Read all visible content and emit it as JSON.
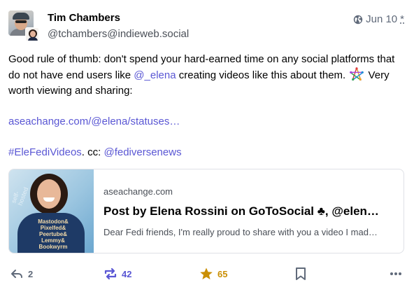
{
  "post": {
    "author": {
      "display_name": "Tim Chambers",
      "handle": "@tchambers@indieweb.social"
    },
    "timestamp": {
      "date": "Jun 10",
      "edited_marker": "*",
      "visibility_icon": "globe-icon"
    },
    "content": {
      "p1_before_mention": "Good rule of thumb: don't spend your hard-earned time on any social platforms that do not have end users like ",
      "p1_mention": "@_elena",
      "p1_after_mention": " creating videos like this about them.",
      "p1_emoji": "fediverse-star-emoji",
      "p1_end": " Very worth viewing and sharing:",
      "link_text": "aseachange.com/@elena/statuses…",
      "hashtag": "#EleFediVideos",
      "cc_text": ". cc: ",
      "cc_mention": "@fediversenews"
    },
    "card": {
      "site": "aseachange.com",
      "title": "Post by Elena Rossini on GoToSocial ♣, @elen…",
      "description": "Dear Fedi friends, I'm really proud to share with you a video I mad…",
      "thumbnail_text": "Mastodon& Pixelfed& Peertube& Lemmy& Bookwyrm",
      "thumbnail_script": "self-hosted"
    },
    "actions": {
      "reply_count": "2",
      "boost_count": "42",
      "favourite_count": "65",
      "colors": {
        "muted": "#606a7a",
        "boost": "#5a57d4",
        "favourite": "#ca8f04",
        "link": "#5a57d4"
      }
    }
  }
}
